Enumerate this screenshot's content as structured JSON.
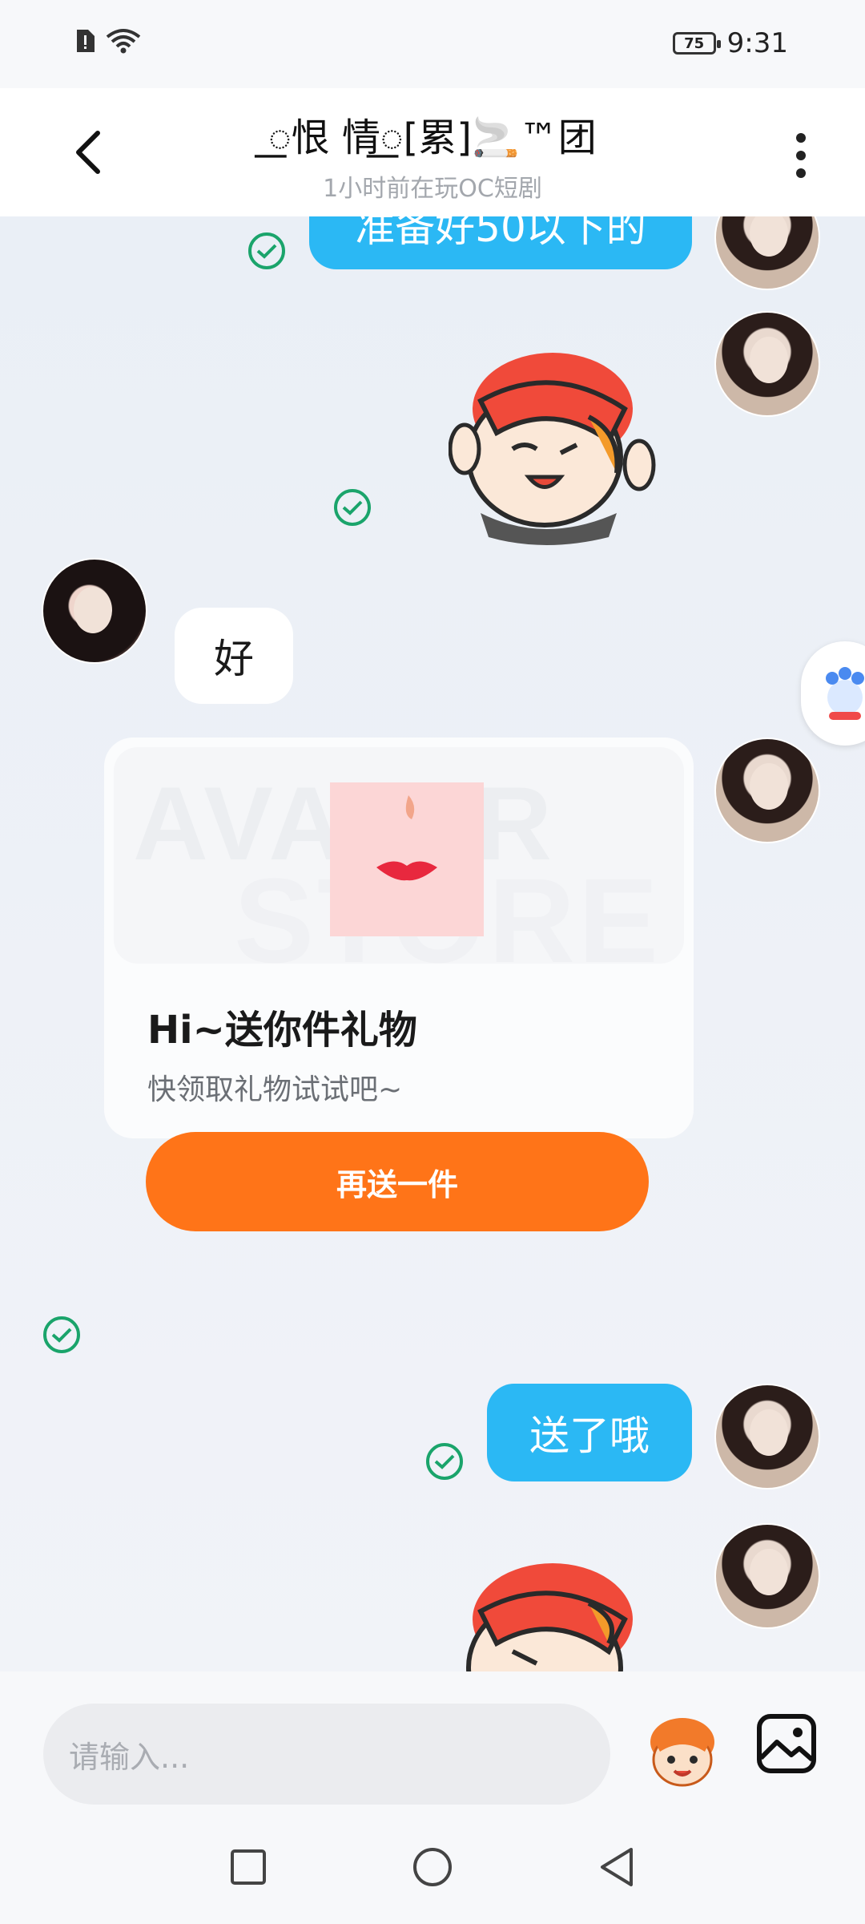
{
  "status": {
    "battery": "75",
    "time": "9:31"
  },
  "header": {
    "title": "꯭恨 情꯭[累]🚬™团",
    "subtitle": "1小时前在玩OC短剧"
  },
  "messages": {
    "top_partial_text": "准备好50以下的",
    "other_reply": "好",
    "sent_text": "送了哦"
  },
  "gift_card": {
    "banner_watermark_1": "AVATAR",
    "banner_watermark_2": "STORE",
    "title": "Hi~送你件礼物",
    "description": "快领取礼物试试吧~",
    "button_label": "再送一件"
  },
  "input": {
    "placeholder": "请输入..."
  },
  "colors": {
    "accent_blue": "#2bb8f4",
    "gift_orange": "#ff7418",
    "read_check": "#1aa46b"
  },
  "icons": [
    "back-arrow-icon",
    "more-vertical-icon",
    "wifi-icon",
    "sim-alert-icon",
    "battery-icon",
    "read-check-icon",
    "sticker-emoji-icon",
    "image-gallery-icon",
    "square-nav-icon",
    "circle-nav-icon",
    "triangle-nav-icon"
  ]
}
